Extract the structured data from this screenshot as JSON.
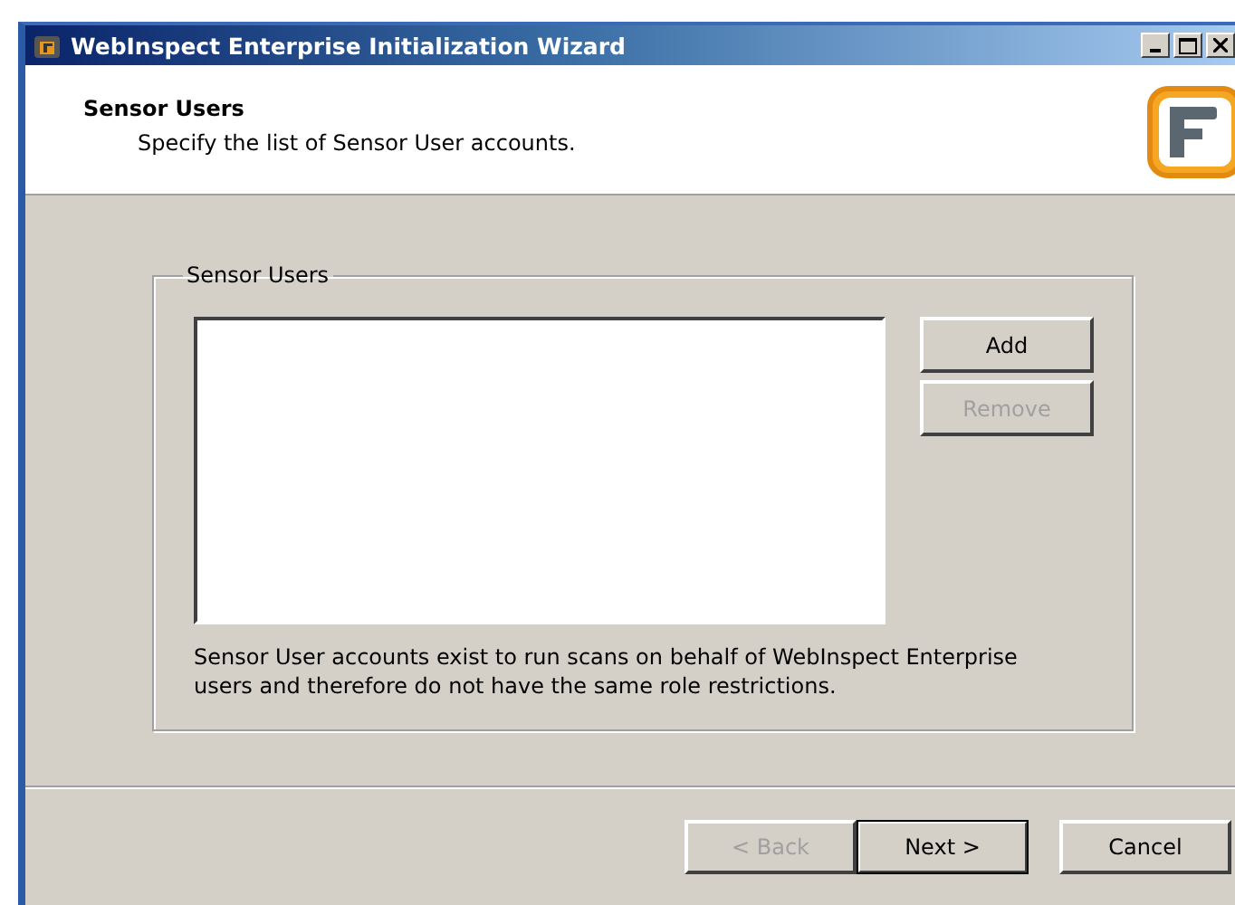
{
  "window": {
    "title": "WebInspect Enterprise Initialization Wizard"
  },
  "header": {
    "title": "Sensor Users",
    "subtitle": "Specify the list of Sensor User accounts."
  },
  "group": {
    "label": "Sensor Users",
    "note": "Sensor User accounts exist to run scans on behalf of WebInspect Enterprise users and therefore do not have the same role restrictions."
  },
  "side_buttons": [
    {
      "label": "Add",
      "disabled": false
    },
    {
      "label": "Remove",
      "disabled": true
    }
  ],
  "nav_buttons": [
    {
      "label": "< Back",
      "disabled": true,
      "default": false
    },
    {
      "label": "Next >",
      "disabled": false,
      "default": true
    },
    {
      "label": "Cancel",
      "disabled": false,
      "default": false
    }
  ]
}
